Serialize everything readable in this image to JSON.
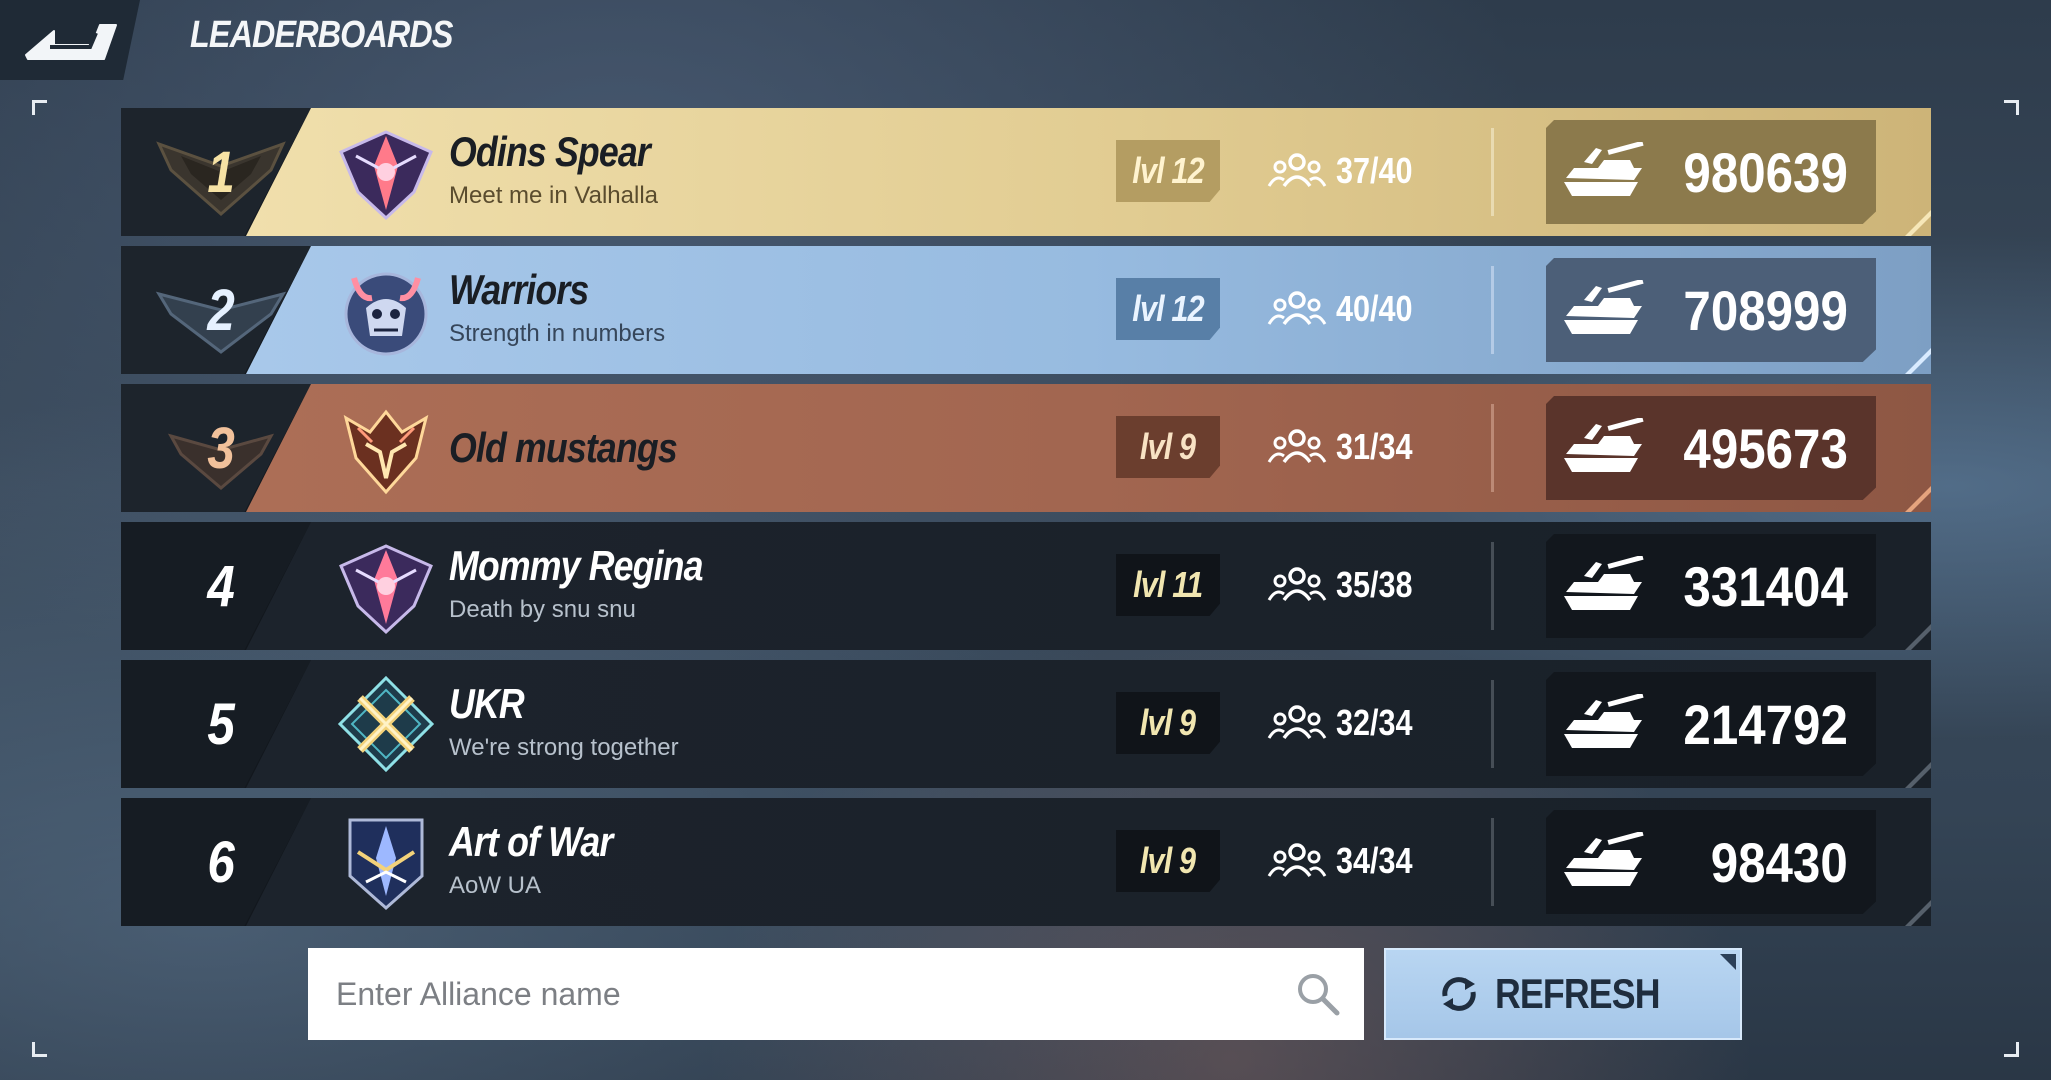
{
  "header": {
    "title": "LEADERBOARDS",
    "back_icon": "back-arrow-icon"
  },
  "leaderboard": {
    "rows": [
      {
        "rank": "1",
        "name": "Odins Spear",
        "motto": "Meet me in Valhalla",
        "level": "lvl 12",
        "members": "37/40",
        "points": "980639",
        "tier": "gold",
        "emblem": "purple-crest-icon"
      },
      {
        "rank": "2",
        "name": "Warriors",
        "motto": "Strength in numbers",
        "level": "lvl 12",
        "members": "40/40",
        "points": "708999",
        "tier": "silver",
        "emblem": "horned-skull-icon"
      },
      {
        "rank": "3",
        "name": "Old mustangs",
        "motto": "",
        "level": "lvl 9",
        "members": "31/34",
        "points": "495673",
        "tier": "bronze",
        "emblem": "golden-beast-icon"
      },
      {
        "rank": "4",
        "name": "Mommy Regina",
        "motto": "Death by snu snu",
        "level": "lvl 11",
        "members": "35/38",
        "points": "331404",
        "tier": "plain",
        "emblem": "purple-crest-icon"
      },
      {
        "rank": "5",
        "name": "UKR",
        "motto": "We're strong together",
        "level": "lvl 9",
        "members": "32/34",
        "points": "214792",
        "tier": "plain",
        "emblem": "crossed-rifles-icon"
      },
      {
        "rank": "6",
        "name": "Art of War",
        "motto": "AoW UA",
        "level": "lvl 9",
        "members": "34/34",
        "points": "98430",
        "tier": "plain",
        "emblem": "blue-shield-icon"
      }
    ]
  },
  "search": {
    "placeholder": "Enter Alliance name"
  },
  "refresh": {
    "label": "REFRESH"
  },
  "colors": {
    "gold": "#e2cd93",
    "silver": "#97bbe0",
    "bronze": "#a26650",
    "row_dark": "#1a2129",
    "refresh_button": "#a5c6e8"
  }
}
